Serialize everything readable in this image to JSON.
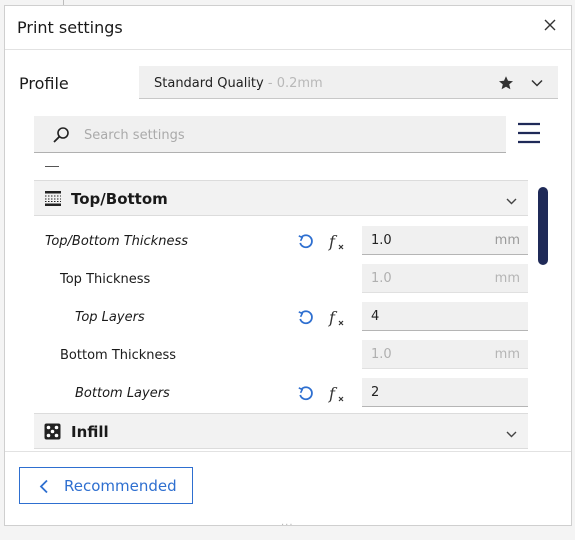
{
  "dialog": {
    "title": "Print settings"
  },
  "profile": {
    "label": "Profile",
    "name": "Standard Quality",
    "sub": "- 0.2mm"
  },
  "search": {
    "placeholder": "Search settings"
  },
  "categories": {
    "top_bottom": "Top/Bottom",
    "infill": "Infill"
  },
  "settings": [
    {
      "label": "Top/Bottom Thickness",
      "value": "1.0",
      "unit": "mm"
    },
    {
      "label": "Top Thickness",
      "value": "1.0",
      "unit": "mm"
    },
    {
      "label": "Top Layers",
      "value": "4",
      "unit": ""
    },
    {
      "label": "Bottom Thickness",
      "value": "1.0",
      "unit": "mm"
    },
    {
      "label": "Bottom Layers",
      "value": "2",
      "unit": ""
    }
  ],
  "footer": {
    "recommended_label": "Recommended"
  },
  "colors": {
    "accent": "#2e6fd0",
    "scrollbar": "#1f2a58"
  },
  "icons": [
    "close-icon",
    "star-icon",
    "chevron-down-icon",
    "search-icon",
    "menu-icon",
    "top-bottom-icon",
    "reset-icon",
    "function-icon",
    "infill-icon",
    "chevron-left-icon"
  ]
}
